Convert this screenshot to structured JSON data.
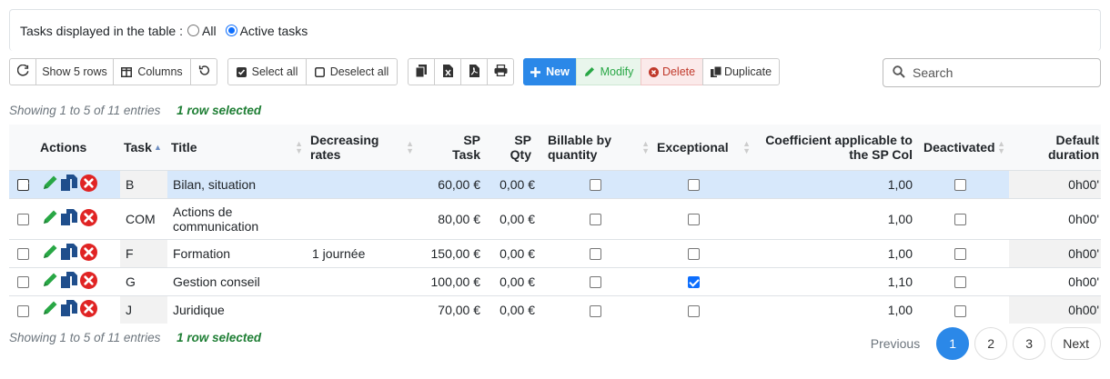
{
  "filter": {
    "label": "Tasks displayed in the table :",
    "options": [
      "All",
      "Active tasks"
    ],
    "selected": "Active tasks"
  },
  "toolbar": {
    "refresh_icon": "refresh-icon",
    "show_rows": "Show 5 rows",
    "columns": "Columns",
    "reset_icon": "undo-icon",
    "select_all": "Select all",
    "deselect_all": "Deselect all",
    "new": "New",
    "modify": "Modify",
    "delete": "Delete",
    "duplicate": "Duplicate"
  },
  "search": {
    "placeholder": "Search"
  },
  "info": {
    "entries": "Showing 1 to 5 of 11 entries",
    "selected": "1 row selected"
  },
  "table": {
    "headers": {
      "actions": "Actions",
      "task": "Task",
      "title": "Title",
      "rates1": "Decreasing",
      "rates2": "rates",
      "sptask1": "SP",
      "sptask2": "Task",
      "spqty1": "SP",
      "spqty2": "Qty",
      "billable1": "Billable by",
      "billable2": "quantity",
      "exceptional": "Exceptional",
      "coef1": "Coefficient applicable to",
      "coef2": "the SP Col",
      "deactivated": "Deactivated",
      "dur1": "Default",
      "dur2": "duration"
    },
    "rows": [
      {
        "task": "B",
        "title": "Bilan, situation",
        "rates": "",
        "sp_task": "60,00 €",
        "sp_qty": "0,00 €",
        "billable": false,
        "exceptional": false,
        "coef": "1,00",
        "deactivated": false,
        "duration": "0h00'",
        "selected": true
      },
      {
        "task": "COM",
        "title": "Actions de communication",
        "rates": "",
        "sp_task": "80,00 €",
        "sp_qty": "0,00 €",
        "billable": false,
        "exceptional": false,
        "coef": "1,00",
        "deactivated": false,
        "duration": "0h00'",
        "selected": false
      },
      {
        "task": "F",
        "title": "Formation",
        "rates": "1 journée",
        "sp_task": "150,00 €",
        "sp_qty": "0,00 €",
        "billable": false,
        "exceptional": false,
        "coef": "1,00",
        "deactivated": false,
        "duration": "0h00'",
        "selected": false
      },
      {
        "task": "G",
        "title": "Gestion conseil",
        "rates": "",
        "sp_task": "100,00 €",
        "sp_qty": "0,00 €",
        "billable": false,
        "exceptional": true,
        "coef": "1,10",
        "deactivated": false,
        "duration": "0h00'",
        "selected": false
      },
      {
        "task": "J",
        "title": "Juridique",
        "rates": "",
        "sp_task": "70,00 €",
        "sp_qty": "0,00 €",
        "billable": false,
        "exceptional": false,
        "coef": "1,00",
        "deactivated": false,
        "duration": "0h00'",
        "selected": false
      }
    ]
  },
  "pagination": {
    "previous": "Previous",
    "pages": [
      "1",
      "2",
      "3"
    ],
    "current": "1",
    "next": "Next"
  },
  "colors": {
    "primary": "#2b88e8",
    "selected_row": "#d7e8fb",
    "edit_icon": "#28a745",
    "delete_icon": "#e02424",
    "copy_icon": "#1f4e8c"
  }
}
